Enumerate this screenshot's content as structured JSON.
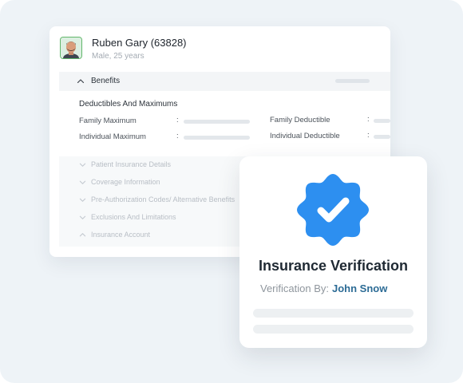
{
  "patient": {
    "name": "Ruben Gary (63828)",
    "subtitle": "Male, 25 years"
  },
  "benefits": {
    "header_label": "Benefits",
    "section_title": "Deductibles And Maximums",
    "fields": [
      {
        "label": "Family Maximum",
        "colon": ":"
      },
      {
        "label": "Family Deductible",
        "colon": ":"
      },
      {
        "label": "Individual Maximum",
        "colon": ":"
      },
      {
        "label": "Individual Deductible",
        "colon": ":"
      }
    ]
  },
  "sections": [
    {
      "label": "Patient Insurance Details",
      "icon": "chevron-down-icon"
    },
    {
      "label": "Coverage Information",
      "icon": "chevron-down-icon"
    },
    {
      "label": "Pre-Authorization Codes/ Alternative Benefits",
      "icon": "chevron-down-icon"
    },
    {
      "label": "Exclusions And Limitations",
      "icon": "chevron-down-icon"
    },
    {
      "label": "Insurance Account",
      "icon": "chevron-up-icon"
    }
  ],
  "verification": {
    "title": "Insurance Verification",
    "by_label": "Verification By:",
    "by_name": "John Snow",
    "badge_icon": "verified-badge-icon"
  },
  "colors": {
    "badge": "#2d8ff0",
    "name_link": "#2c6b95",
    "avatar_border": "#62b66b"
  }
}
